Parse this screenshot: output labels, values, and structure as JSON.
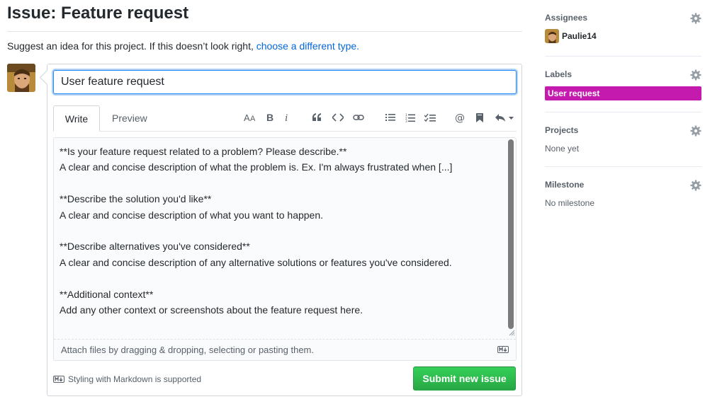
{
  "page": {
    "title": "Issue: Feature request",
    "subtitle_text": "Suggest an idea for this project. If this doesn’t look right,",
    "subtitle_link": "choose a different type."
  },
  "form": {
    "title_value": "User feature request",
    "tabs": {
      "write": "Write",
      "preview": "Preview"
    },
    "toolbar": {
      "heading": "heading-icon",
      "bold": "bold-icon",
      "italic": "italic-icon",
      "quote": "quote-icon",
      "code": "code-icon",
      "link": "link-icon",
      "bullet_list": "bullet-list-icon",
      "numbered_list": "numbered-list-icon",
      "task_list": "task-list-icon",
      "mention": "mention-icon",
      "saved_reply": "bookmark-icon",
      "reply": "reply-icon"
    },
    "body_lines": [
      "**Is your feature request related to a problem? Please describe.**",
      "A clear and concise description of what the problem is. Ex. I'm always frustrated when [...]",
      "",
      "**Describe the solution you'd like**",
      "A clear and concise description of what you want to happen.",
      "",
      "**Describe alternatives you've considered**",
      "A clear and concise description of any alternative solutions or features you've considered.",
      "",
      "**Additional context**",
      "Add any other context or screenshots about the feature request here."
    ],
    "attach_text": "Attach files by dragging & dropping, selecting or pasting them.",
    "markdown_note": "Styling with Markdown is supported",
    "submit_label": "Submit new issue"
  },
  "sidebar": {
    "assignees": {
      "heading": "Assignees",
      "user": "Paulie14"
    },
    "labels": {
      "heading": "Labels",
      "label": "User request",
      "label_color": "#c41aad"
    },
    "projects": {
      "heading": "Projects",
      "value": "None yet"
    },
    "milestone": {
      "heading": "Milestone",
      "value": "No milestone"
    }
  },
  "colors": {
    "link": "#0366d6",
    "submit_green": "#2cbe4e",
    "focus_blue": "#2188ff"
  }
}
